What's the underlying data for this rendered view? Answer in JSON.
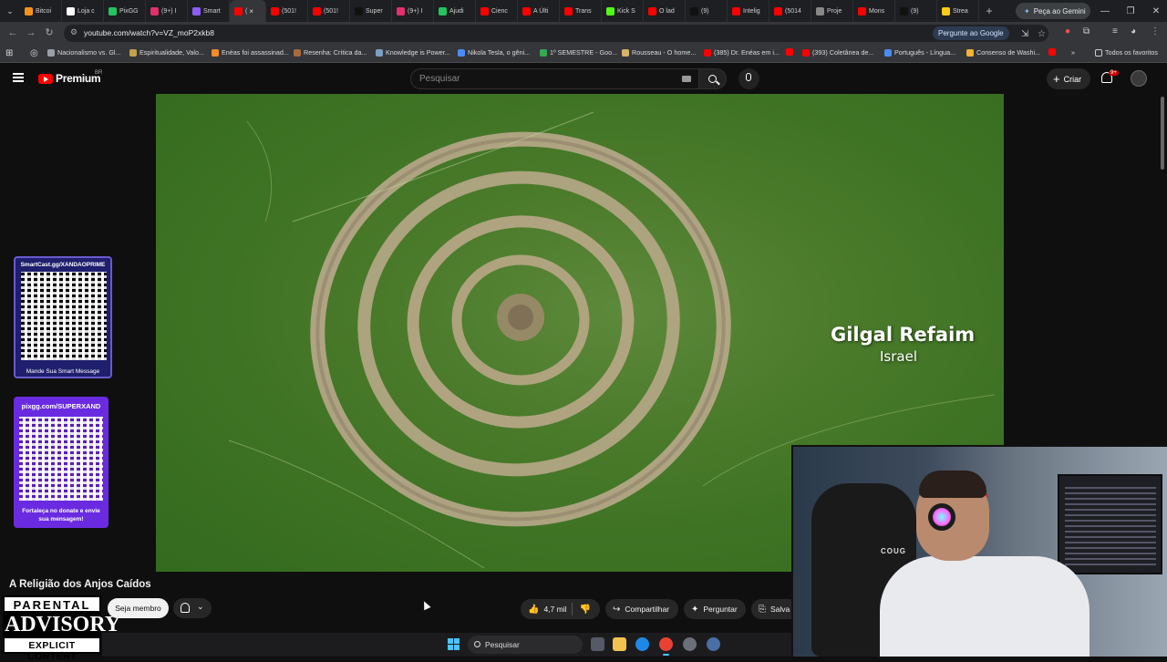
{
  "browser": {
    "tabs": [
      {
        "label": "Bitcoi",
        "color": "#f7931a"
      },
      {
        "label": "Loja c",
        "color": "#ffffff"
      },
      {
        "label": "PixGG",
        "color": "#22c55e"
      },
      {
        "label": "(9+) I",
        "color": "#e1306c"
      },
      {
        "label": "Smart",
        "color": "#8b5cf6"
      },
      {
        "label": "(",
        "color": "#ff0000",
        "active": true
      },
      {
        "label": "(501!",
        "color": "#ff0000"
      },
      {
        "label": "(501!",
        "color": "#ff0000"
      },
      {
        "label": "Super",
        "color": "#111111"
      },
      {
        "label": "(9+) I",
        "color": "#e1306c"
      },
      {
        "label": "Ajudi",
        "color": "#22c55e"
      },
      {
        "label": "Cienc",
        "color": "#ff0000"
      },
      {
        "label": "A Últi",
        "color": "#ff0000"
      },
      {
        "label": "Trans",
        "color": "#ff0000"
      },
      {
        "label": "Kick S",
        "color": "#53fc18"
      },
      {
        "label": "O lad",
        "color": "#ff0000"
      },
      {
        "label": "(9)",
        "color": "#111111"
      },
      {
        "label": "Intelig",
        "color": "#ff0000"
      },
      {
        "label": "(5014",
        "color": "#ff0000"
      },
      {
        "label": "Proje",
        "color": "#888888"
      },
      {
        "label": "Mons",
        "color": "#ff0000"
      },
      {
        "label": "(9)",
        "color": "#111111"
      },
      {
        "label": "Strea",
        "color": "#facc15"
      }
    ],
    "new_tab": "+",
    "gemini_button": "Peça ao Gemini",
    "url": "youtube.com/watch?v=VZ_moP2xkb8",
    "ask_google": "Pergunte ao Google",
    "bookmarks": [
      {
        "label": "Nacionalismo vs. Gl...",
        "color": "#9aa0a6"
      },
      {
        "label": "Espiritualidade, Valo...",
        "color": "#c2a14a"
      },
      {
        "label": "Enéas foi assassinad...",
        "color": "#f28c28"
      },
      {
        "label": "Resenha: Crítica da...",
        "color": "#a86a3a"
      },
      {
        "label": "Knowledge is Power...",
        "color": "#7aa0c4"
      },
      {
        "label": "Nikola Tesla, o gêni...",
        "color": "#4c8bf5"
      },
      {
        "label": "1º SEMESTRE - Goo...",
        "color": "#34a853"
      },
      {
        "label": "Rousseau - O home...",
        "color": "#d8b36a"
      },
      {
        "label": "(385) Dr. Enéas em i...",
        "color": "#ff0000"
      },
      {
        "label": "",
        "color": "#ff0000"
      },
      {
        "label": "(393) Coletânea de...",
        "color": "#ff0000"
      },
      {
        "label": "Português - Língua...",
        "color": "#4c8bf5"
      },
      {
        "label": "Consenso de Washi...",
        "color": "#f2b233"
      },
      {
        "label": "",
        "color": "#ff0000"
      }
    ],
    "all_bookmarks": "Todos os favoritos"
  },
  "youtube": {
    "brand": "Premium",
    "country": "BR",
    "search_placeholder": "Pesquisar",
    "create_label": "Criar",
    "notif_badge": "9+"
  },
  "video": {
    "caption_title": "Gilgal Refaim",
    "caption_subtitle": "Israel",
    "title": "A Religião dos Anjos Caídos",
    "member_button": "Seja membro",
    "likes": "4,7 mil",
    "share": "Compartilhar",
    "ask": "Perguntar",
    "save": "Salva"
  },
  "overlays": {
    "smartcast_url": "SmartCast.gg/XANDAOPRIME",
    "smartcast_caption": "Mande Sua Smart Message",
    "pix_url": "pixgg.com/SUPERXAND",
    "pix_caption": "Fortaleça no donate e envie sua mensagem!",
    "advisory_top": "PARENTAL",
    "advisory_mid": "ADVISORY",
    "advisory_bot": "EXPLICIT CONTENT",
    "chair_brand": "COUG"
  },
  "taskbar": {
    "search_placeholder": "Pesquisar"
  }
}
